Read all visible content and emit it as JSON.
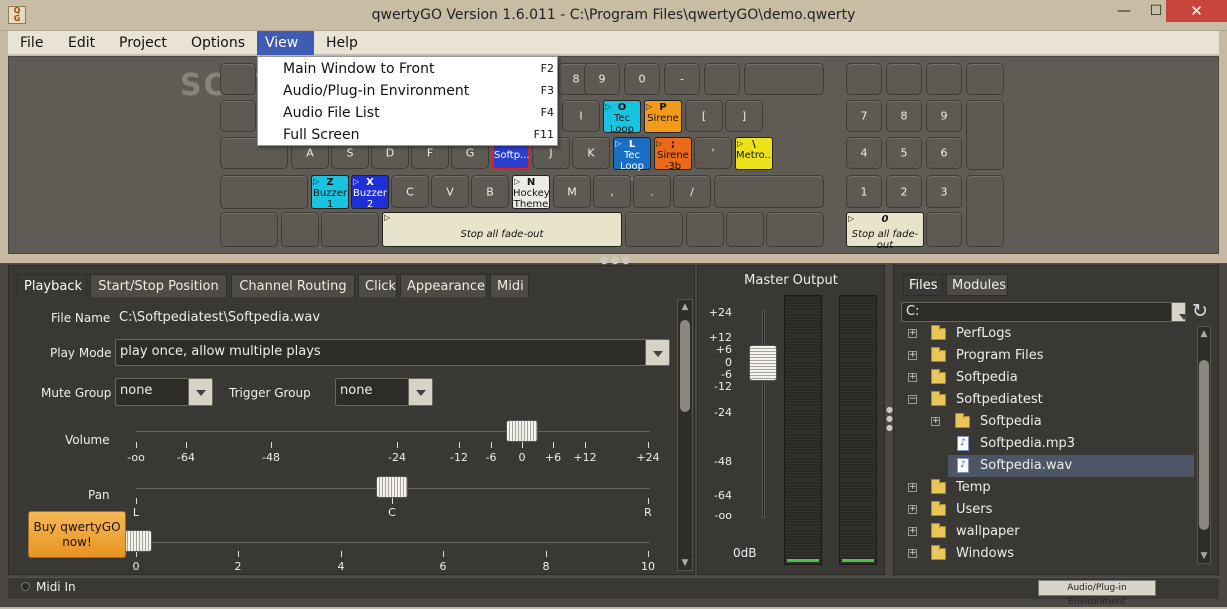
{
  "window": {
    "title": "qwertyGO Version 1.6.011 - C:\\Program Files\\qwertyGO\\demo.qwerty",
    "icon_text": "Q G",
    "minimize": "—",
    "maximize": "☐",
    "close": "✕"
  },
  "menu": {
    "items": [
      "File",
      "Edit",
      "Project",
      "Options",
      "View",
      "Help"
    ],
    "active": "View"
  },
  "view_menu": [
    {
      "label": "Main Window to Front",
      "key": "F2"
    },
    {
      "label": "Audio/Plug-in Environment",
      "key": "F3"
    },
    {
      "label": "Audio File List",
      "key": "F4"
    },
    {
      "label": "Full Screen",
      "key": "F11"
    }
  ],
  "watermark": "SOFTPEDIA",
  "keyboard": {
    "row1": [
      "8",
      "9",
      "0",
      "-"
    ],
    "row2": [
      "I",
      "[",
      "]"
    ],
    "row3": [
      "A",
      "S",
      "D",
      "F",
      "G",
      "J",
      "K",
      "'"
    ],
    "row4": [
      "C",
      "V",
      "B",
      "M",
      ",",
      ".",
      "/"
    ],
    "assigned": {
      "o": {
        "key": "O",
        "name": "Tec Loop",
        "color": "#19c4de"
      },
      "p": {
        "key": "P",
        "name": "Sirene",
        "color": "#f29a1a"
      },
      "h": {
        "key": "",
        "name": "Softp...",
        "color": "#2a3fcc"
      },
      "l": {
        "key": "L",
        "name": "Tec Loop ...",
        "color": "#1a6fc4"
      },
      "semi": {
        "key": ";",
        "name": "Sirene -3b",
        "color": "#ea6a1a"
      },
      "bs": {
        "key": "\\",
        "name": "Metro...",
        "color": "#ece21a"
      },
      "z": {
        "key": "Z",
        "name": "Buzzer 1",
        "color": "#19c4de"
      },
      "x": {
        "key": "X",
        "name": "Buzzer 2",
        "color": "#1e2fd8"
      },
      "n": {
        "key": "N",
        "name": "Hockey Theme",
        "color": "#ecebe6"
      },
      "space": {
        "name": "Stop all fade-out"
      },
      "num0": {
        "key": "0",
        "name": "Stop all fade-out"
      }
    },
    "numpad": [
      "7",
      "8",
      "9",
      "4",
      "5",
      "6",
      "1",
      "2",
      "3"
    ]
  },
  "tabs": [
    "Playback",
    "Start/Stop Position",
    "Channel Routing",
    "Click",
    "Appearance",
    "Midi"
  ],
  "playback": {
    "file_name_label": "File Name",
    "file_name": "C:\\Softpediatest\\Softpedia.wav",
    "play_mode_label": "Play Mode",
    "play_mode": "play once, allow multiple plays",
    "mute_group_label": "Mute Group",
    "mute_group": "none",
    "trigger_group_label": "Trigger Group",
    "trigger_group": "none",
    "volume_label": "Volume",
    "volume_ticks": [
      "-oo",
      "-64",
      "-48",
      "-24",
      "-12",
      "-6",
      "0",
      "+6",
      "+12",
      "+24"
    ],
    "volume_value_db": 0,
    "pan_label": "Pan",
    "pan_ticks": [
      "L",
      "C",
      "R"
    ],
    "pan_value": "C",
    "third_ticks": [
      "0",
      "2",
      "4",
      "6",
      "8",
      "10"
    ],
    "third_value": 0
  },
  "buy_button": "Buy qwertyGO now!",
  "master": {
    "title": "Master Output",
    "scale": [
      "+24",
      "+12",
      "+6",
      "0",
      "-6",
      "-12",
      "-24",
      "-48",
      "-64",
      "-oo"
    ],
    "readout": "0dB",
    "fader_db": 0
  },
  "files": {
    "tabs": [
      "Files",
      "Modules"
    ],
    "drive": "C:",
    "tree": [
      {
        "label": "PerfLogs",
        "type": "folder",
        "level": 0
      },
      {
        "label": "Program Files",
        "type": "folder",
        "level": 0
      },
      {
        "label": "Softpedia",
        "type": "folder",
        "level": 0
      },
      {
        "label": "Softpediatest",
        "type": "folder",
        "level": 0,
        "expanded": true
      },
      {
        "label": "Softpedia",
        "type": "folder",
        "level": 1
      },
      {
        "label": "Softpedia.mp3",
        "type": "file",
        "level": 1
      },
      {
        "label": "Softpedia.wav",
        "type": "file",
        "level": 1,
        "selected": true
      },
      {
        "label": "Temp",
        "type": "folder",
        "level": 0
      },
      {
        "label": "Users",
        "type": "folder",
        "level": 0
      },
      {
        "label": "wallpaper",
        "type": "folder",
        "level": 0
      },
      {
        "label": "Windows",
        "type": "folder",
        "level": 0
      }
    ]
  },
  "status": {
    "midi_in": "Midi In",
    "env_button": "Audio/Plug-in Environment"
  }
}
